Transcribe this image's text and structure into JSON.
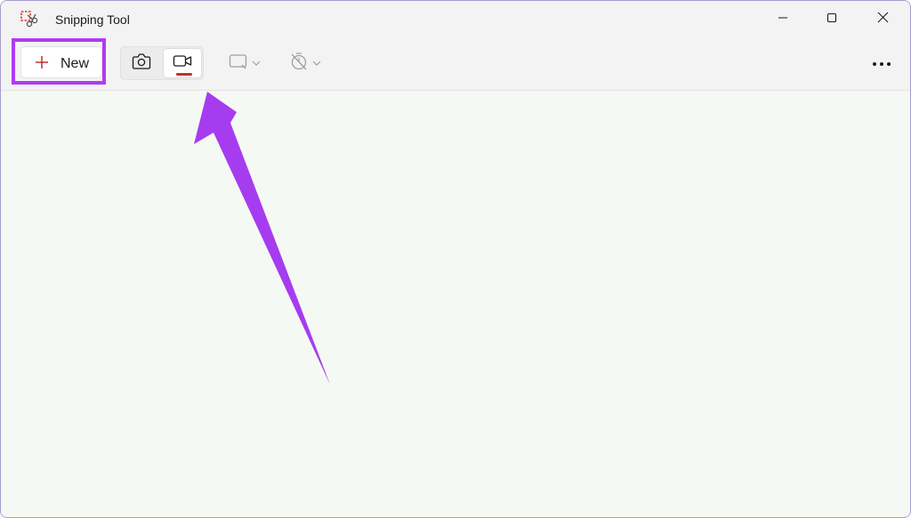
{
  "window": {
    "title": "Snipping Tool",
    "app_icon": "scissors-icon"
  },
  "window_controls": [
    {
      "name": "minimize",
      "icon": "minimize-icon"
    },
    {
      "name": "maximize",
      "icon": "maximize-icon"
    },
    {
      "name": "close",
      "icon": "close-icon"
    }
  ],
  "toolbar": {
    "new_label": "New",
    "new_icon": "plus-icon",
    "modes": [
      {
        "name": "snip",
        "icon": "camera-icon",
        "selected": false
      },
      {
        "name": "record",
        "icon": "video-camera-icon",
        "selected": true
      }
    ],
    "snip_shape_icon": "rectangle-snip-icon",
    "delay_icon": "no-timer-icon",
    "more_icon": "more-options-icon"
  },
  "colors": {
    "highlight": "#b13af2",
    "arrow": "#a63cf0",
    "accent": "#c4302b",
    "content_bg": "#f5f9f3"
  }
}
